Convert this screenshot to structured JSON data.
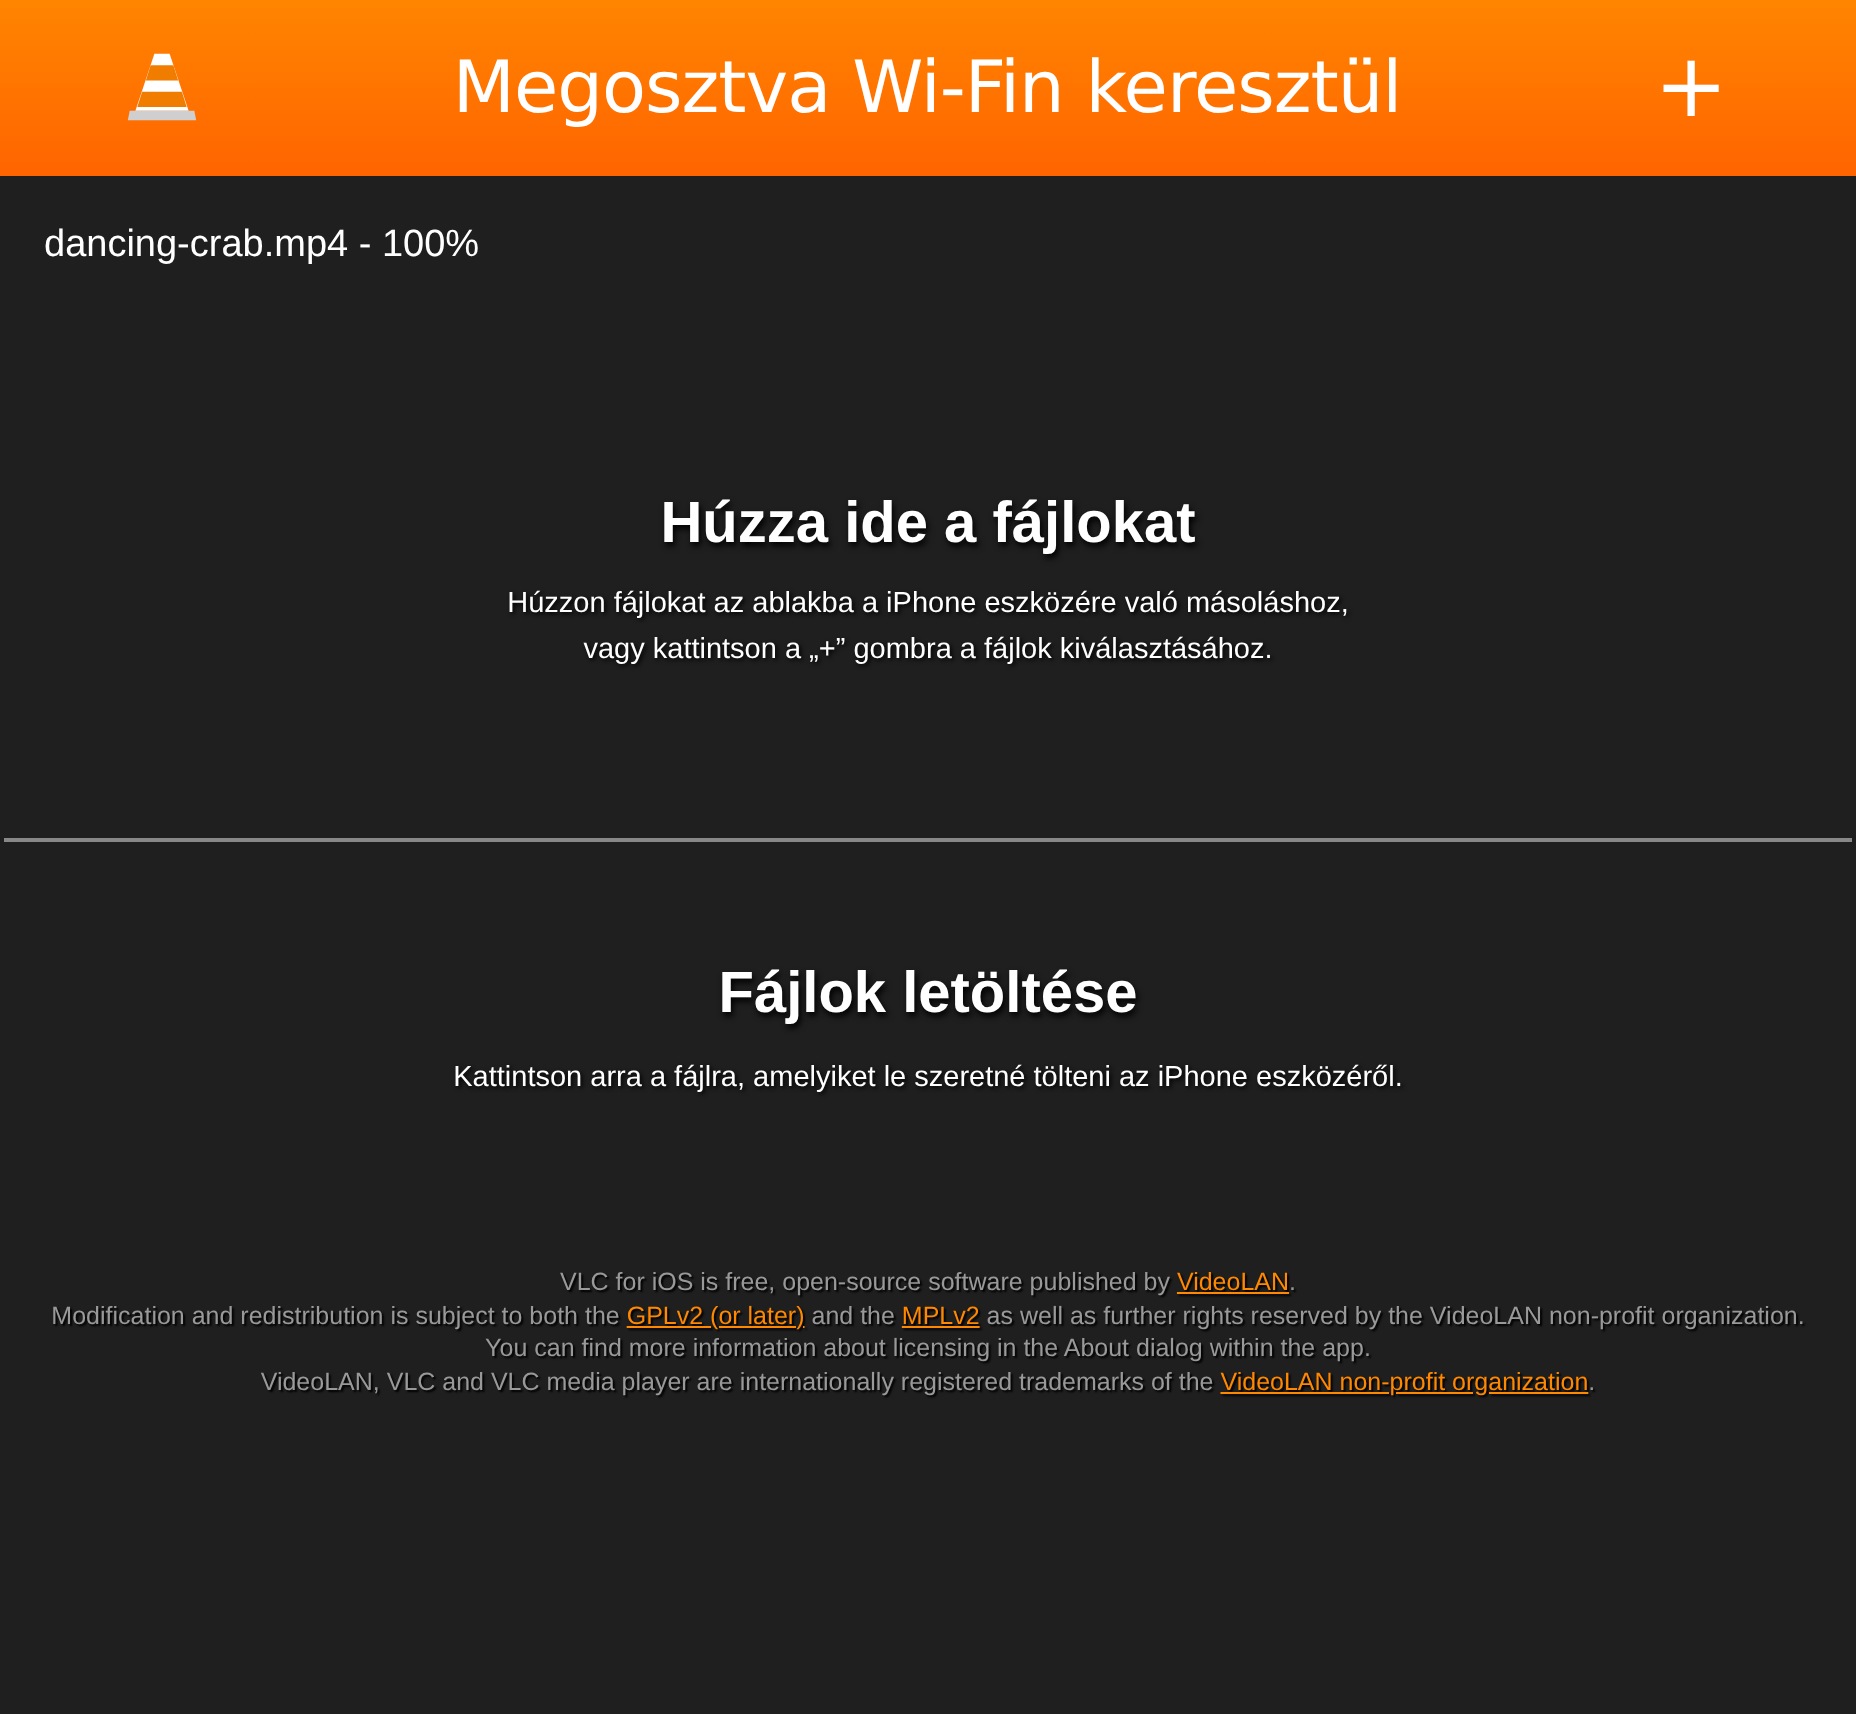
{
  "header": {
    "title": "Megosztva Wi-Fin keresztül",
    "add_button": "+"
  },
  "uploads": [
    {
      "label": "dancing-crab.mp4 - 100%"
    }
  ],
  "drop_section": {
    "heading": "Húzza ide a fájlokat",
    "lines": [
      "Húzzon fájlokat az ablakba a iPhone eszközére való másoláshoz,",
      "vagy kattintson a „+” gombra a fájlok kiválasztásához."
    ]
  },
  "download_section": {
    "heading": "Fájlok letöltése",
    "lines": [
      "Kattintson arra a fájlra, amelyiket le szeretné tölteni az iPhone eszközéről."
    ]
  },
  "footer": [
    [
      {
        "kind": "text",
        "text": "VLC for iOS is free, open-source software published by "
      },
      {
        "kind": "link",
        "text": "VideoLAN"
      },
      {
        "kind": "text",
        "text": "."
      }
    ],
    [
      {
        "kind": "text",
        "text": "Modification and redistribution is subject to both the "
      },
      {
        "kind": "link",
        "text": "GPLv2 (or later)"
      },
      {
        "kind": "text",
        "text": " and the "
      },
      {
        "kind": "link",
        "text": "MPLv2"
      },
      {
        "kind": "text",
        "text": " as well as further rights reserved by the VideoLAN non-profit organization."
      }
    ],
    [
      {
        "kind": "text",
        "text": "You can find more information about licensing in the About dialog within the app."
      }
    ],
    [
      {
        "kind": "text",
        "text": "VideoLAN, VLC and VLC media player are internationally registered trademarks of the "
      },
      {
        "kind": "link",
        "text": "VideoLAN non-profit organization"
      },
      {
        "kind": "text",
        "text": "."
      }
    ]
  ]
}
